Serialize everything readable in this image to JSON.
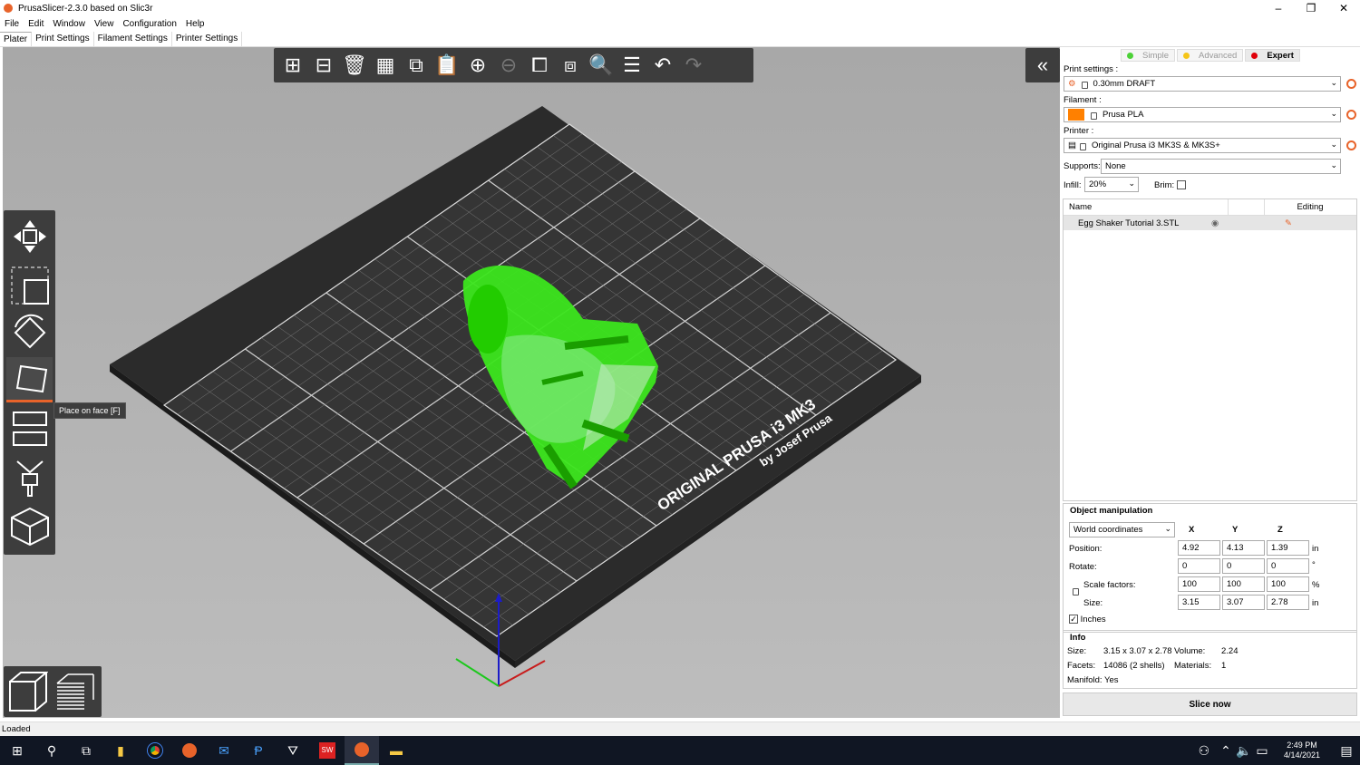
{
  "window": {
    "title": "PrusaSlicer-2.3.0 based on Slic3r",
    "minimize": "–",
    "restore": "❐",
    "close": "✕"
  },
  "menu": [
    "File",
    "Edit",
    "Window",
    "View",
    "Configuration",
    "Help"
  ],
  "tabs": [
    "Plater",
    "Print Settings",
    "Filament Settings",
    "Printer Settings"
  ],
  "tooltip": "Place on face [F]",
  "bed_text": {
    "line1": "ORIGINAL PRUSA i3 MK3",
    "line2": "by Josef Prusa"
  },
  "modes": {
    "simple": "Simple",
    "advanced": "Advanced",
    "expert": "Expert",
    "simple_color": "#4cd137",
    "advanced_color": "#f5c518",
    "expert_color": "#e0000a"
  },
  "print_settings": {
    "label": "Print settings :",
    "value": "0.30mm DRAFT"
  },
  "filament": {
    "label": "Filament :",
    "value": "Prusa PLA",
    "color": "#ff8000"
  },
  "printer": {
    "label": "Printer :",
    "value": "Original Prusa i3 MK3S & MK3S+"
  },
  "supports": {
    "label": "Supports:",
    "value": "None"
  },
  "infill": {
    "label": "Infill:",
    "value": "20%"
  },
  "brim": {
    "label": "Brim:",
    "checked": false
  },
  "object_list": {
    "col_name": "Name",
    "col_editing": "Editing",
    "items": [
      {
        "name": "Egg Shaker Tutorial 3.STL"
      }
    ]
  },
  "object_manipulation": {
    "title": "Object manipulation",
    "coord_system": "World coordinates",
    "axes": [
      "X",
      "Y",
      "Z"
    ],
    "position": {
      "label": "Position:",
      "x": "4.92",
      "y": "4.13",
      "z": "1.39",
      "unit": "in"
    },
    "rotate": {
      "label": "Rotate:",
      "x": "0",
      "y": "0",
      "z": "0",
      "unit": "°"
    },
    "scale": {
      "label": "Scale factors:",
      "x": "100",
      "y": "100",
      "z": "100",
      "unit": "%"
    },
    "size": {
      "label": "Size:",
      "x": "3.15",
      "y": "3.07",
      "z": "2.78",
      "unit": "in"
    },
    "inches": {
      "label": "Inches",
      "checked": true
    }
  },
  "info": {
    "title": "Info",
    "size_label": "Size:",
    "size_value": "3.15 x 3.07 x 2.78",
    "volume_label": "Volume:",
    "volume_value": "2.24",
    "facets_label": "Facets:",
    "facets_value": "14086 (2 shells)",
    "materials_label": "Materials:",
    "materials_value": "1",
    "manifold_label": "Manifold:",
    "manifold_value": "Yes"
  },
  "slice_button": "Slice now",
  "status": "Loaded",
  "clock": {
    "time": "2:49 PM",
    "date": "4/14/2021"
  },
  "colors": {
    "accent": "#e8632a",
    "model": "#22cc00",
    "bed": "#2b2b2b",
    "viewport": "#b0b0b0",
    "toolbar": "#3d3d3d"
  }
}
